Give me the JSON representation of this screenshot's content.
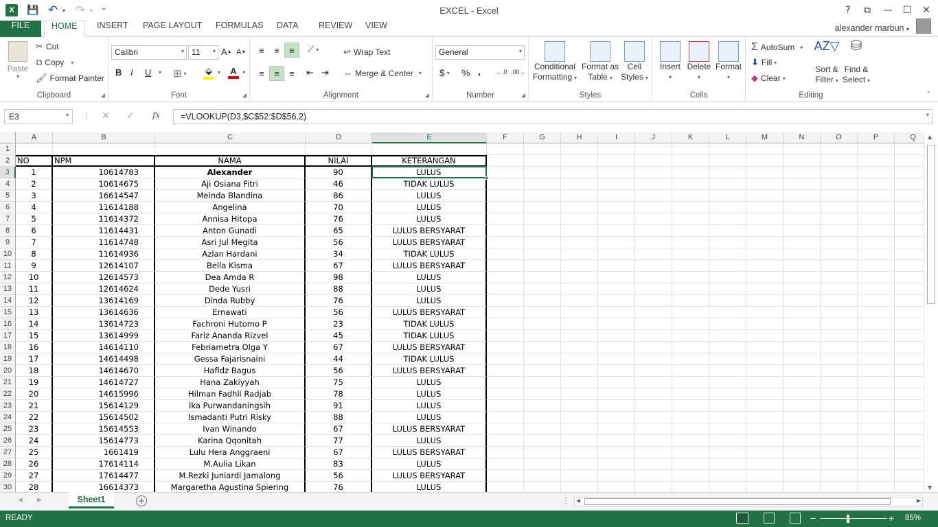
{
  "window": {
    "title": "EXCEL - Excel",
    "help": "?",
    "ribbon_display": "⧉",
    "minimize": "—",
    "maximize": "☐",
    "close": "✕"
  },
  "qat": {
    "save": "💾",
    "undo": "↶",
    "redo": "↷",
    "customize": "⁼"
  },
  "tabs": [
    "FILE",
    "HOME",
    "INSERT",
    "PAGE LAYOUT",
    "FORMULAS",
    "DATA",
    "REVIEW",
    "VIEW"
  ],
  "active_tab": "HOME",
  "user": {
    "name": "alexander marbun"
  },
  "ribbon": {
    "clipboard": {
      "label": "Clipboard",
      "paste": "Paste",
      "cut": "Cut",
      "copy": "Copy",
      "format_painter": "Format Painter"
    },
    "font": {
      "label": "Font",
      "family": "Calibri",
      "size": "11",
      "grow": "A",
      "shrink": "A",
      "bold": "B",
      "italic": "I",
      "underline": "U"
    },
    "alignment": {
      "label": "Alignment",
      "wrap_text": "Wrap Text",
      "merge_center": "Merge & Center"
    },
    "number": {
      "label": "Number",
      "format": "General",
      "currency": "$",
      "percent": "%",
      "comma": ","
    },
    "styles": {
      "label": "Styles",
      "conditional_1": "Conditional",
      "conditional_2": "Formatting",
      "format_table_1": "Format as",
      "format_table_2": "Table",
      "cell_styles_1": "Cell",
      "cell_styles_2": "Styles"
    },
    "cells": {
      "label": "Cells",
      "insert": "Insert",
      "delete": "Delete",
      "format": "Format"
    },
    "editing": {
      "label": "Editing",
      "autosum": "AutoSum",
      "fill": "Fill",
      "clear": "Clear",
      "sort_1": "Sort &",
      "sort_2": "Filter",
      "find_1": "Find &",
      "find_2": "Select"
    }
  },
  "formula_bar": {
    "name_box": "E3",
    "fx": "fx",
    "formula": "=VLOOKUP(D3,$C$52:$D$56,2)"
  },
  "columns": [
    "A",
    "B",
    "C",
    "D",
    "E",
    "F",
    "G",
    "H",
    "I",
    "J",
    "K",
    "L",
    "M",
    "N",
    "O",
    "P",
    "Q"
  ],
  "header_row": {
    "no": "NO",
    "npm": "NPM",
    "nama": "NAMA",
    "nilai": "NILAI",
    "keterangan": "KETERANGAN"
  },
  "rows": [
    {
      "no": "1",
      "npm": "10614783",
      "nama": "Alexander",
      "nilai": "90",
      "ket": "LULUS"
    },
    {
      "no": "2",
      "npm": "10614675",
      "nama": "Aji Osiana Fitri",
      "nilai": "46",
      "ket": "TIDAK LULUS"
    },
    {
      "no": "3",
      "npm": "16614547",
      "nama": "Meinda Blandina",
      "nilai": "86",
      "ket": "LULUS"
    },
    {
      "no": "4",
      "npm": "11614188",
      "nama": "Angelina",
      "nilai": "70",
      "ket": "LULUS"
    },
    {
      "no": "5",
      "npm": "11614372",
      "nama": "Annisa Hitopa",
      "nilai": "76",
      "ket": "LULUS"
    },
    {
      "no": "6",
      "npm": "11614431",
      "nama": "Anton Gunadi",
      "nilai": "65",
      "ket": "LULUS BERSYARAT"
    },
    {
      "no": "7",
      "npm": "11614748",
      "nama": "Asri Jul Megita",
      "nilai": "56",
      "ket": "LULUS BERSYARAT"
    },
    {
      "no": "8",
      "npm": "11614936",
      "nama": "Azlan Hardani",
      "nilai": "34",
      "ket": "TIDAK LULUS"
    },
    {
      "no": "9",
      "npm": "12614107",
      "nama": "Bella Kisma",
      "nilai": "67",
      "ket": "LULUS BERSYARAT"
    },
    {
      "no": "10",
      "npm": "12614573",
      "nama": "Dea Amda R",
      "nilai": "98",
      "ket": "LULUS"
    },
    {
      "no": "11",
      "npm": "12614624",
      "nama": "Dede Yusri",
      "nilai": "88",
      "ket": "LULUS"
    },
    {
      "no": "12",
      "npm": "13614169",
      "nama": "Dinda Rubby",
      "nilai": "76",
      "ket": "LULUS"
    },
    {
      "no": "13",
      "npm": "13614636",
      "nama": "Ernawati",
      "nilai": "56",
      "ket": "LULUS BERSYARAT"
    },
    {
      "no": "14",
      "npm": "13614723",
      "nama": "Fachroni Hutomo P",
      "nilai": "23",
      "ket": "TIDAK LULUS"
    },
    {
      "no": "15",
      "npm": "13614999",
      "nama": "Fariz Ananda Rizvel",
      "nilai": "45",
      "ket": "TIDAK LULUS"
    },
    {
      "no": "16",
      "npm": "14614110",
      "nama": "Febriametra Olga Y",
      "nilai": "67",
      "ket": "LULUS BERSYARAT"
    },
    {
      "no": "17",
      "npm": "14614498",
      "nama": "Gessa Fajarisnaini",
      "nilai": "44",
      "ket": "TIDAK LULUS"
    },
    {
      "no": "18",
      "npm": "14614670",
      "nama": "Hafidz Bagus",
      "nilai": "56",
      "ket": "LULUS BERSYARAT"
    },
    {
      "no": "19",
      "npm": "14614727",
      "nama": "Hana Zakiyyah",
      "nilai": "75",
      "ket": "LULUS"
    },
    {
      "no": "20",
      "npm": "14615996",
      "nama": "Hilman Fadhli Radjab",
      "nilai": "78",
      "ket": "LULUS"
    },
    {
      "no": "21",
      "npm": "15614129",
      "nama": "Ika Purwandaningsih",
      "nilai": "91",
      "ket": "LULUS"
    },
    {
      "no": "22",
      "npm": "15614502",
      "nama": "Ismadanti Putri Risky",
      "nilai": "88",
      "ket": "LULUS"
    },
    {
      "no": "23",
      "npm": "15614553",
      "nama": "Ivan Winando",
      "nilai": "67",
      "ket": "LULUS BERSYARAT"
    },
    {
      "no": "24",
      "npm": "15614773",
      "nama": "Karina Qqonitah",
      "nilai": "77",
      "ket": "LULUS"
    },
    {
      "no": "25",
      "npm": "1661419",
      "nama": "Lulu Hera Anggraeni",
      "nilai": "67",
      "ket": "LULUS BERSYARAT"
    },
    {
      "no": "26",
      "npm": "17614114",
      "nama": "M.Aulia Likan",
      "nilai": "83",
      "ket": "LULUS"
    },
    {
      "no": "27",
      "npm": "17614477",
      "nama": "M.Rezki Juniardi Jamalong",
      "nilai": "56",
      "ket": "LULUS BERSYARAT"
    },
    {
      "no": "28",
      "npm": "16614373",
      "nama": "Margaretha Agustina Spiering",
      "nilai": "76",
      "ket": "LULUS"
    }
  ],
  "sheets": [
    "Sheet1"
  ],
  "status": {
    "mode": "READY",
    "zoom": "85%"
  },
  "colors": {
    "accent": "#217346",
    "selection": "#217346"
  }
}
